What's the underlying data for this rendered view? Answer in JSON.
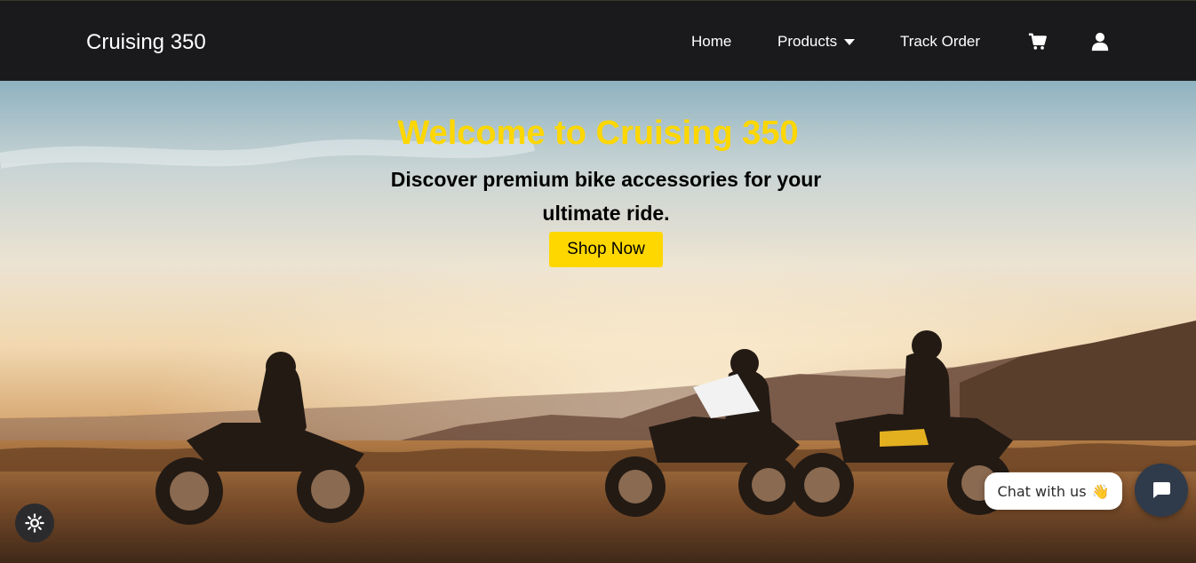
{
  "brand": "Cruising 350",
  "nav": {
    "home": "Home",
    "products": "Products",
    "track_order": "Track Order",
    "icons": [
      "cart-icon",
      "user-icon",
      "caret-down-icon"
    ]
  },
  "hero": {
    "title": "Welcome to Cruising 350",
    "subtitle": "Discover premium bike accessories for your ultimate ride.",
    "cta": "Shop Now"
  },
  "chat": {
    "label": "Chat with us",
    "emoji": "👋"
  },
  "colors": {
    "accent": "#ffd700",
    "navbar": "#1a1a1c",
    "chat_button": "#2f3a4a"
  }
}
